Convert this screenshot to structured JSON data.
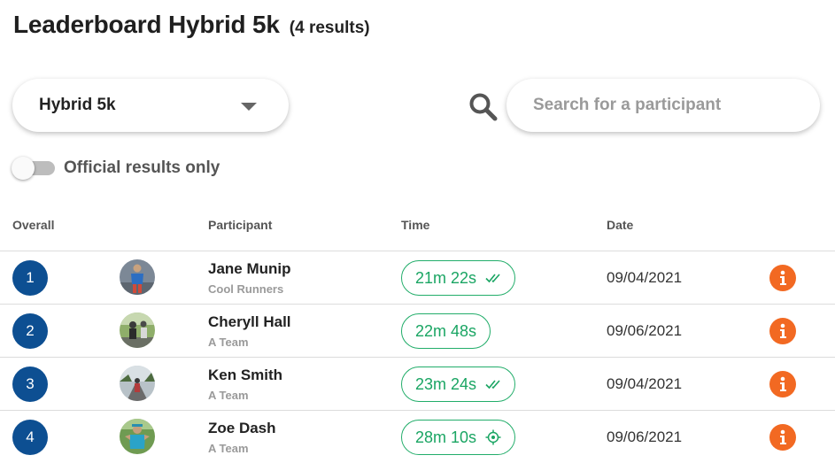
{
  "page": {
    "title": "Leaderboard Hybrid 5k",
    "result_count": "(4 results)"
  },
  "filters": {
    "event_selected": "Hybrid 5k",
    "search_placeholder": "Search for a participant",
    "search_value": "",
    "official_only_label": "Official results only",
    "official_only_checked": false
  },
  "table": {
    "columns": [
      "Overall",
      "Participant",
      "Time",
      "Date"
    ],
    "rows": [
      {
        "rank": "1",
        "name": "Jane Munip",
        "team": "Cool Runners",
        "time": "21m 22s",
        "time_icon": "double-check-icon",
        "date": "09/04/2021"
      },
      {
        "rank": "2",
        "name": "Cheryll Hall",
        "team": "A Team",
        "time": "22m 48s",
        "time_icon": "",
        "date": "09/06/2021"
      },
      {
        "rank": "3",
        "name": "Ken Smith",
        "team": "A Team",
        "time": "23m 24s",
        "time_icon": "double-check-icon",
        "date": "09/04/2021"
      },
      {
        "rank": "4",
        "name": "Zoe Dash",
        "team": "A Team",
        "time": "28m 10s",
        "time_icon": "gps-target-icon",
        "date": "09/06/2021"
      }
    ]
  },
  "colors": {
    "rank_badge": "#0d4f92",
    "time_accent": "#1aa563",
    "info_button": "#f26922"
  }
}
